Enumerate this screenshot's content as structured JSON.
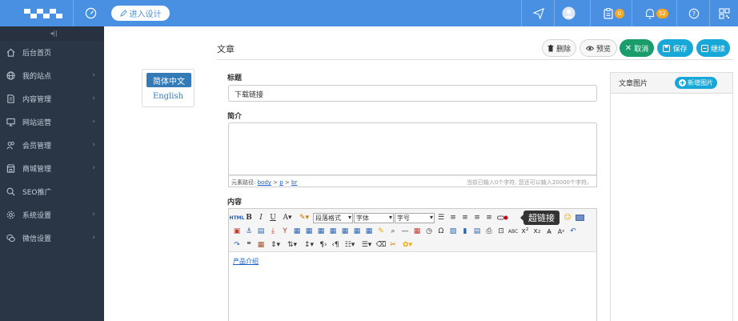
{
  "header": {
    "design_button": "进入设计",
    "badge_tasks": "0",
    "badge_notifications": "52"
  },
  "sidebar": {
    "items": [
      {
        "label": "后台首页",
        "icon": "home-icon",
        "chevron": false
      },
      {
        "label": "我的站点",
        "icon": "globe-icon",
        "chevron": true
      },
      {
        "label": "内容管理",
        "icon": "document-icon",
        "chevron": true
      },
      {
        "label": "网站运营",
        "icon": "monitor-icon",
        "chevron": true
      },
      {
        "label": "会员管理",
        "icon": "users-icon",
        "chevron": true
      },
      {
        "label": "商城管理",
        "icon": "shop-icon",
        "chevron": true
      },
      {
        "label": "SEO推广",
        "icon": "search-icon",
        "chevron": false
      },
      {
        "label": "系统设置",
        "icon": "gear-icon",
        "chevron": true
      },
      {
        "label": "微信设置",
        "icon": "chat-icon",
        "chevron": true
      }
    ]
  },
  "language": {
    "active": "简体中文",
    "other": "English"
  },
  "page": {
    "title": "文章",
    "actions": {
      "delete": "删除",
      "preview": "预览",
      "cancel": "取消",
      "save": "保存",
      "continue": "继续"
    }
  },
  "form": {
    "title_label": "标题",
    "title_value": "下载链接",
    "summary_label": "简介",
    "path_prefix": "元素路径:",
    "path": [
      "body",
      "p",
      "br"
    ],
    "char_count": "当前已输入0个字符, 您还可以输入20000个字符。",
    "content_label": "内容",
    "content_link": "产品介绍"
  },
  "editor": {
    "format_select": "段落格式",
    "font_select": "字体",
    "size_select": "字号",
    "tooltip": "超链接"
  },
  "image_panel": {
    "title": "文章图片",
    "add_button": "新增图片"
  }
}
